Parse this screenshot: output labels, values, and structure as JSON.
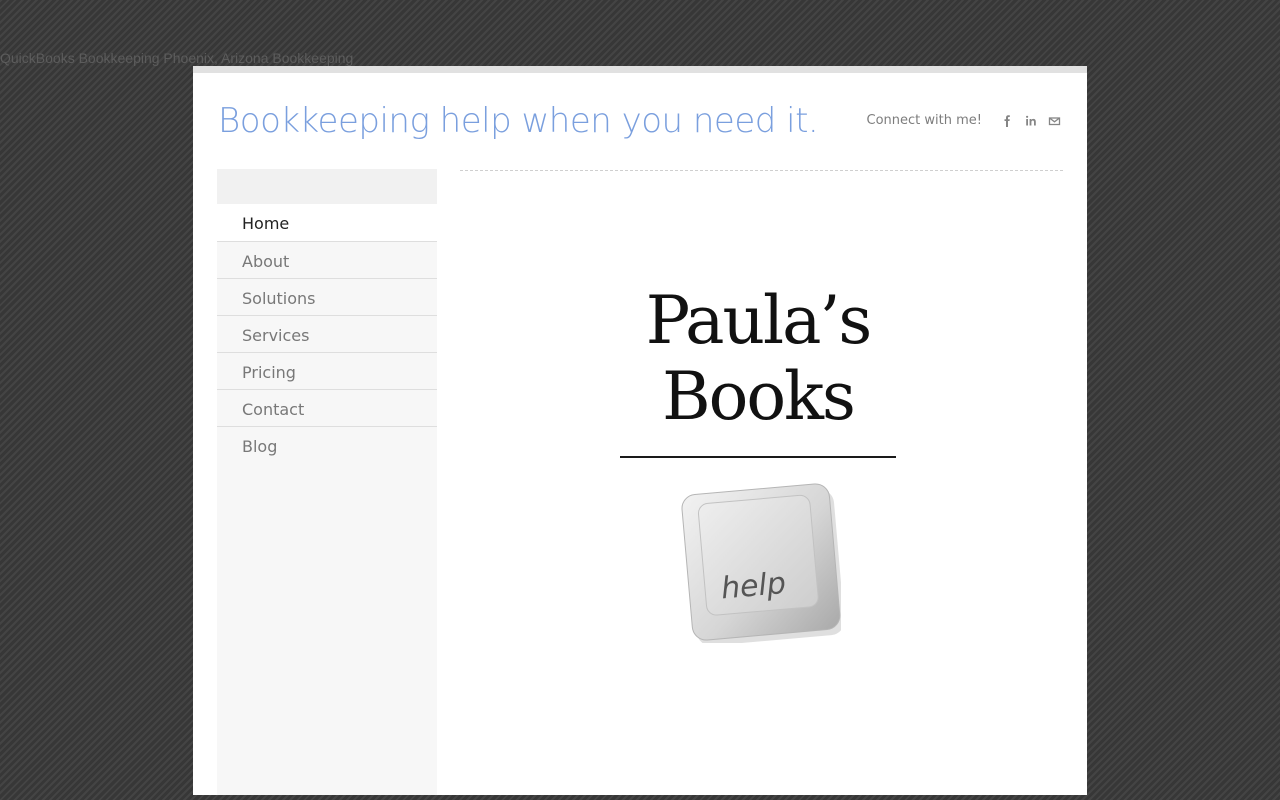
{
  "page": {
    "seo_title": "QuickBooks Bookkeeping Phoenix, Arizona Bookkeeping"
  },
  "header": {
    "site_title": "Bookkeeping help when you need it.",
    "connect_text": "Connect with me!",
    "social": [
      {
        "name": "facebook-icon"
      },
      {
        "name": "linkedin-icon"
      },
      {
        "name": "email-icon"
      }
    ]
  },
  "nav": {
    "items": [
      {
        "label": "Home",
        "active": true
      },
      {
        "label": "About"
      },
      {
        "label": "Solutions"
      },
      {
        "label": "Services"
      },
      {
        "label": "Pricing"
      },
      {
        "label": "Contact"
      },
      {
        "label": "Blog"
      }
    ]
  },
  "main": {
    "logo_line1": "Paula’s",
    "logo_line2": "Books",
    "key_label": "help"
  },
  "colors": {
    "title": "#7a9fde",
    "background": "#3c3c3c",
    "sidebar": "#f7f7f7"
  }
}
